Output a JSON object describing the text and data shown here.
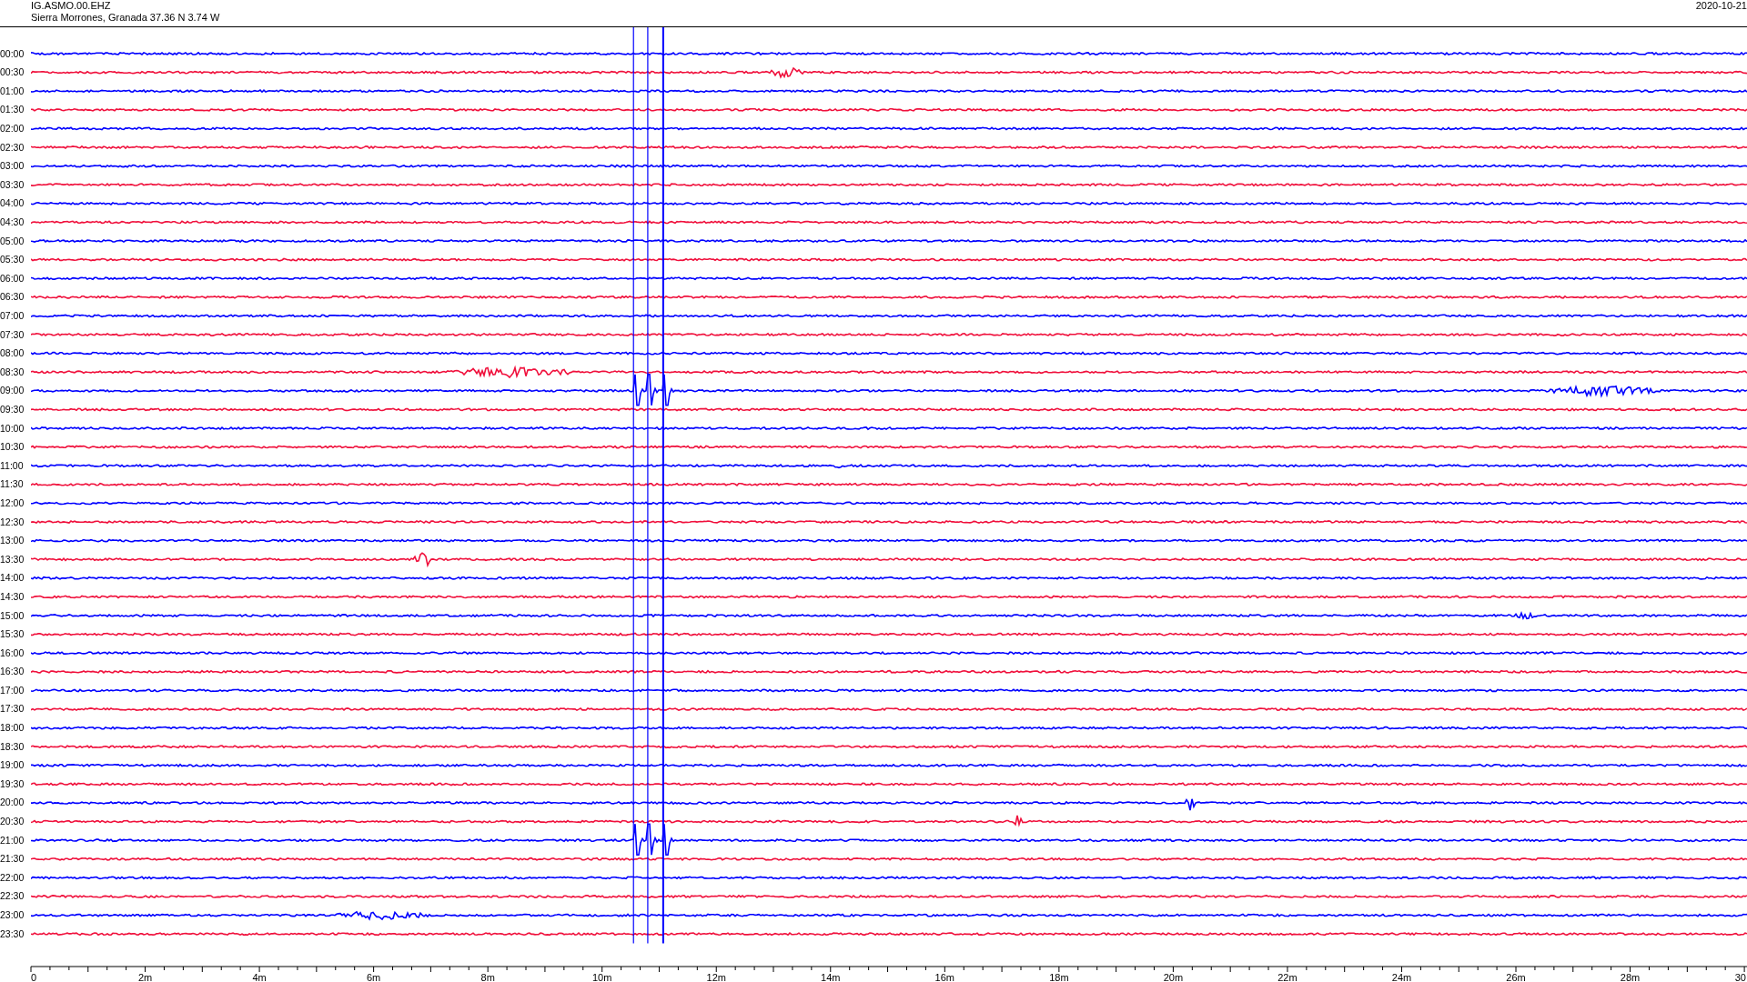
{
  "header": {
    "channel": "IG.ASMO.00.EHZ",
    "station": "Sierra Morrones, Granada  37.36 N 3.74 W",
    "date": "2020-10-21"
  },
  "rows": [
    {
      "time": "00:00",
      "color": "#0000ff"
    },
    {
      "time": "00:30",
      "color": "#f0103c"
    },
    {
      "time": "01:00",
      "color": "#0000ff"
    },
    {
      "time": "01:30",
      "color": "#f0103c"
    },
    {
      "time": "02:00",
      "color": "#0000ff"
    },
    {
      "time": "02:30",
      "color": "#f0103c"
    },
    {
      "time": "03:00",
      "color": "#0000ff"
    },
    {
      "time": "03:30",
      "color": "#f0103c"
    },
    {
      "time": "04:00",
      "color": "#0000ff"
    },
    {
      "time": "04:30",
      "color": "#f0103c"
    },
    {
      "time": "05:00",
      "color": "#0000ff"
    },
    {
      "time": "05:30",
      "color": "#f0103c"
    },
    {
      "time": "06:00",
      "color": "#0000ff"
    },
    {
      "time": "06:30",
      "color": "#f0103c"
    },
    {
      "time": "07:00",
      "color": "#0000ff"
    },
    {
      "time": "07:30",
      "color": "#f0103c"
    },
    {
      "time": "08:00",
      "color": "#0000ff"
    },
    {
      "time": "08:30",
      "color": "#f0103c"
    },
    {
      "time": "09:00",
      "color": "#0000ff"
    },
    {
      "time": "09:30",
      "color": "#f0103c"
    },
    {
      "time": "10:00",
      "color": "#0000ff"
    },
    {
      "time": "10:30",
      "color": "#f0103c"
    },
    {
      "time": "11:00",
      "color": "#0000ff"
    },
    {
      "time": "11:30",
      "color": "#f0103c"
    },
    {
      "time": "12:00",
      "color": "#0000ff"
    },
    {
      "time": "12:30",
      "color": "#f0103c"
    },
    {
      "time": "13:00",
      "color": "#0000ff"
    },
    {
      "time": "13:30",
      "color": "#f0103c"
    },
    {
      "time": "14:00",
      "color": "#0000ff"
    },
    {
      "time": "14:30",
      "color": "#f0103c"
    },
    {
      "time": "15:00",
      "color": "#0000ff"
    },
    {
      "time": "15:30",
      "color": "#f0103c"
    },
    {
      "time": "16:00",
      "color": "#0000ff"
    },
    {
      "time": "16:30",
      "color": "#f0103c"
    },
    {
      "time": "17:00",
      "color": "#0000ff"
    },
    {
      "time": "17:30",
      "color": "#f0103c"
    },
    {
      "time": "18:00",
      "color": "#0000ff"
    },
    {
      "time": "18:30",
      "color": "#f0103c"
    },
    {
      "time": "19:00",
      "color": "#0000ff"
    },
    {
      "time": "19:30",
      "color": "#f0103c"
    },
    {
      "time": "20:00",
      "color": "#0000ff"
    },
    {
      "time": "20:30",
      "color": "#f0103c"
    },
    {
      "time": "21:00",
      "color": "#0000ff"
    },
    {
      "time": "21:30",
      "color": "#f0103c"
    },
    {
      "time": "22:00",
      "color": "#0000ff"
    },
    {
      "time": "22:30",
      "color": "#f0103c"
    },
    {
      "time": "23:00",
      "color": "#0000ff"
    },
    {
      "time": "23:30",
      "color": "#f0103c"
    }
  ],
  "axis": {
    "labels": [
      "0",
      "2m",
      "4m",
      "6m",
      "8m",
      "10m",
      "12m",
      "14m",
      "16m",
      "18m",
      "20m",
      "22m",
      "24m",
      "26m",
      "28m",
      "30"
    ]
  }
}
